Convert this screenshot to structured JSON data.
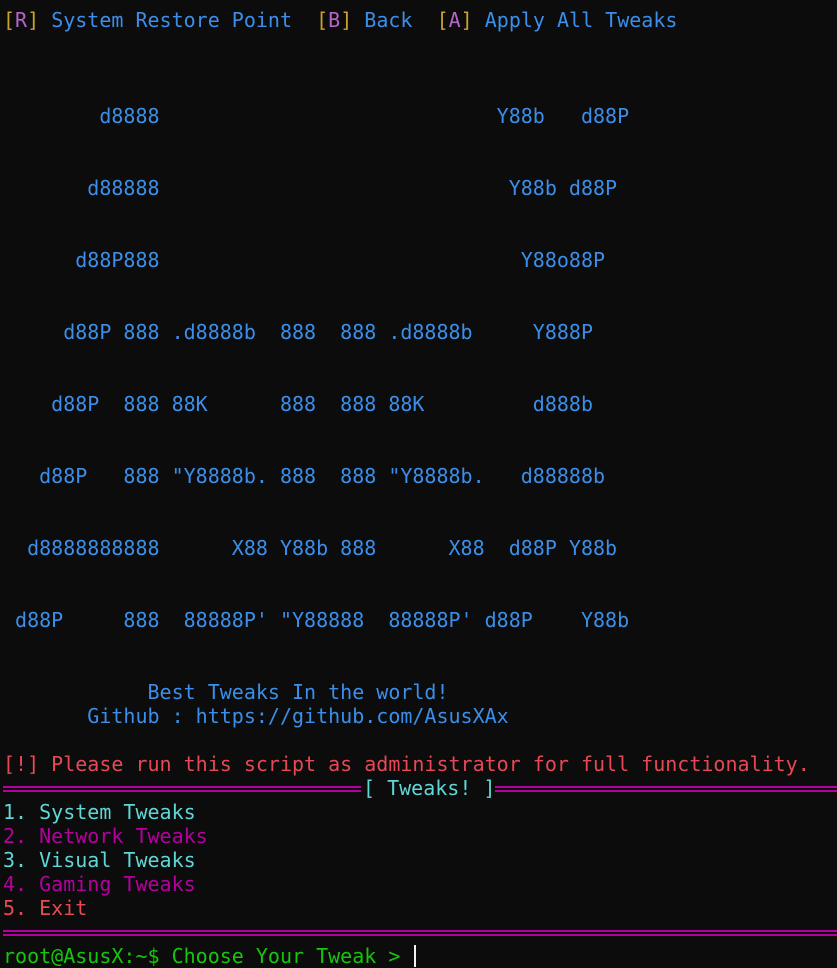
{
  "header_menu": [
    {
      "open": "[",
      "key": "R",
      "close": "]",
      "label": "System Restore Point"
    },
    {
      "open": "[",
      "key": "B",
      "close": "]",
      "label": "Back"
    },
    {
      "open": "[",
      "key": "A",
      "close": "]",
      "label": "Apply All Tweaks"
    }
  ],
  "ascii_art": [
    "        d8888                            Y88b   d88P",
    "       d88888                             Y88b d88P",
    "      d88P888                              Y88o88P",
    "     d88P 888 .d8888b  888  888 .d8888b     Y888P",
    "    d88P  888 88K      888  888 88K         d888b",
    "   d88P   888 \"Y8888b. 888  888 \"Y8888b.   d88888b",
    "  d8888888888      X88 Y88b 888      X88  d88P Y88b",
    " d88P     888  88888P' \"Y88888  88888P' d88P    Y88b"
  ],
  "banner": {
    "tagline": "            Best Tweaks In the world!",
    "github": "       Github : https://github.com/AsusXAx"
  },
  "warning": "[!] Please run this script as administrator for full functionality.",
  "section": {
    "title": "[ Tweaks! ]"
  },
  "options": [
    {
      "text": "1. System Tweaks",
      "color": "#5fd7d7"
    },
    {
      "text": "2. Network Tweaks",
      "color": "#b4009e"
    },
    {
      "text": "3. Visual Tweaks",
      "color": "#5fd7d7"
    },
    {
      "text": "4. Gaming Tweaks",
      "color": "#b4009e"
    },
    {
      "text": "5. Exit",
      "color": "#e74856"
    }
  ],
  "prompt": {
    "user_host": "root@AsusX:~$",
    "text": "Choose Your Tweak >",
    "input_value": ""
  },
  "colors": {
    "background": "#0c0c0c",
    "ascii": "#3b8eea",
    "bracket": "#c9a227",
    "key_letter": "#b565c9",
    "warning": "#e74856",
    "divider": "#b4009e",
    "cyan": "#5fd7d7",
    "prompt_green": "#16c60c"
  }
}
